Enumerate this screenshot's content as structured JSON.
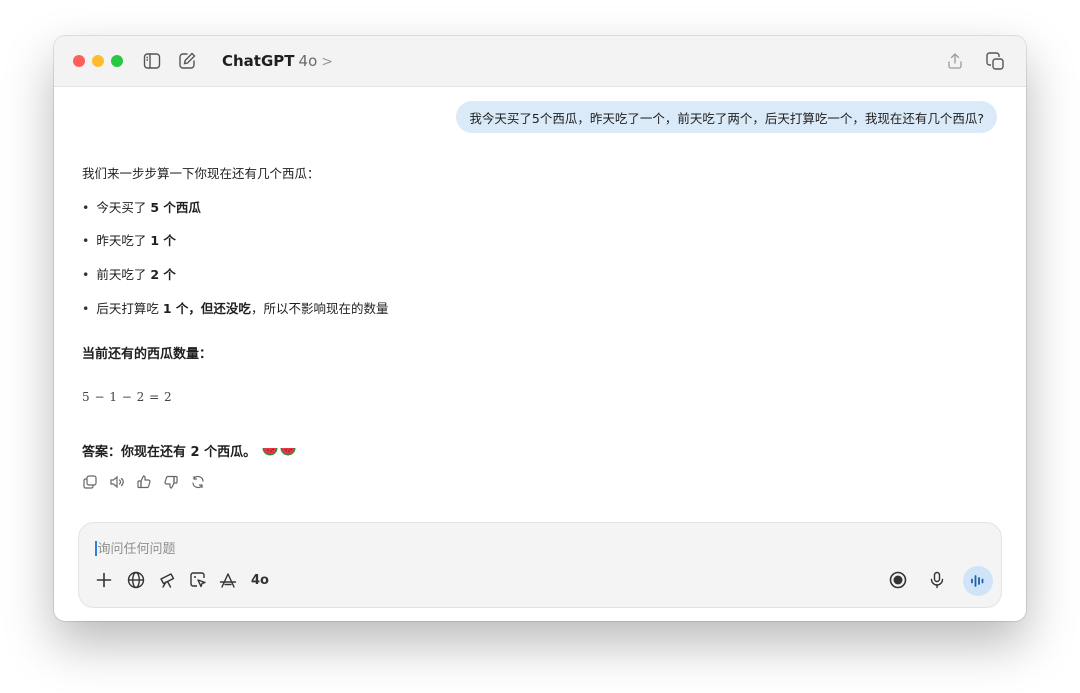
{
  "titlebar": {
    "app_name": "ChatGPT",
    "model": "4o",
    "chevron": ">"
  },
  "conversation": {
    "user_message": "我今天买了5个西瓜，昨天吃了一个，前天吃了两个，后天打算吃一个，我现在还有几个西瓜?",
    "intro": "我们来一步步算一下你现在还有几个西瓜：",
    "bullets": [
      {
        "text": "今天买了",
        "bold": "5 个西瓜"
      },
      {
        "text": "昨天吃了",
        "bold": "1 个"
      },
      {
        "text": "前天吃了",
        "bold": "2 个"
      },
      {
        "text": "后天打算吃",
        "bold": "1 个，但还没吃",
        "suffix": "，所以不影响现在的数量"
      }
    ],
    "subheading": "当前还有的西瓜数量：",
    "formula": "5 − 1 − 2 = 2",
    "answer": "答案：你现在还有 2 个西瓜。"
  },
  "composer": {
    "placeholder": "询问任何问题",
    "model_label": "4o"
  },
  "icons": {
    "titlebar": [
      "sidebar-icon",
      "new-chat-icon",
      "share-icon",
      "popout-icon"
    ],
    "actions": [
      "copy-icon",
      "read-aloud-icon",
      "thumbs-up-icon",
      "thumbs-down-icon",
      "regenerate-icon"
    ],
    "composer": [
      "plus-icon",
      "globe-icon",
      "telescope-icon",
      "canvas-icon",
      "tools-icon",
      "record-icon",
      "mic-icon",
      "voice-mode-icon"
    ]
  },
  "colors": {
    "user_bubble": "#dbeaf8",
    "voice_button": "#cfe4f8",
    "traffic_red": "#ff5f57",
    "traffic_yellow": "#febc2e",
    "traffic_green": "#28c840"
  }
}
